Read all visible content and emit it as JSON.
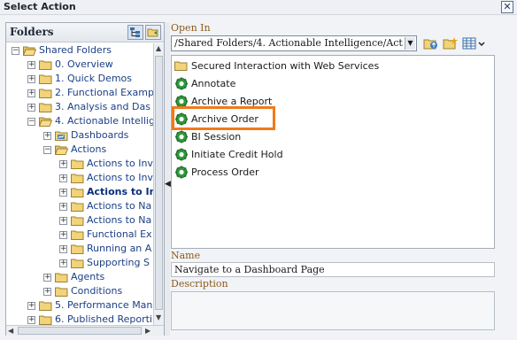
{
  "window": {
    "title": "Select Action",
    "close_glyph": "✕"
  },
  "folders_panel": {
    "header": "Folders",
    "tree": [
      {
        "label": "Shared Folders",
        "level": 0,
        "expander": "−",
        "icon": "folder-open-icon"
      },
      {
        "label": "0. Overview",
        "level": 1,
        "expander": "+",
        "icon": "folder-icon"
      },
      {
        "label": "1. Quick Demos",
        "level": 1,
        "expander": "+",
        "icon": "folder-icon"
      },
      {
        "label": "2. Functional Examp",
        "level": 1,
        "expander": "+",
        "icon": "folder-icon"
      },
      {
        "label": "3. Analysis and Das",
        "level": 1,
        "expander": "+",
        "icon": "folder-icon"
      },
      {
        "label": "4. Actionable Intellig",
        "level": 1,
        "expander": "−",
        "icon": "folder-open-icon"
      },
      {
        "label": "Dashboards",
        "level": 2,
        "expander": "+",
        "icon": "dashboard-folder-icon"
      },
      {
        "label": "Actions",
        "level": 2,
        "expander": "−",
        "icon": "folder-open-icon"
      },
      {
        "label": "Actions to Inv",
        "level": 3,
        "expander": "+",
        "icon": "folder-icon"
      },
      {
        "label": "Actions to Inv",
        "level": 3,
        "expander": "+",
        "icon": "folder-icon"
      },
      {
        "label": "Actions to In",
        "level": 3,
        "expander": "+",
        "icon": "folder-icon",
        "selected": true
      },
      {
        "label": "Actions to Na",
        "level": 3,
        "expander": "+",
        "icon": "folder-icon"
      },
      {
        "label": "Actions to Na",
        "level": 3,
        "expander": "+",
        "icon": "folder-icon"
      },
      {
        "label": "Functional Ex",
        "level": 3,
        "expander": "+",
        "icon": "folder-icon"
      },
      {
        "label": "Running an A",
        "level": 3,
        "expander": "+",
        "icon": "folder-icon"
      },
      {
        "label": "Supporting S",
        "level": 3,
        "expander": "+",
        "icon": "folder-icon"
      },
      {
        "label": "Agents",
        "level": 2,
        "expander": "+",
        "icon": "folder-icon"
      },
      {
        "label": "Conditions",
        "level": 2,
        "expander": "+",
        "icon": "folder-icon"
      },
      {
        "label": "5. Performance Man",
        "level": 1,
        "expander": "+",
        "icon": "folder-icon"
      },
      {
        "label": "6. Published Reporti",
        "level": 1,
        "expander": "+",
        "icon": "folder-icon"
      }
    ]
  },
  "open_in": {
    "label": "Open In",
    "path": "/Shared Folders/4. Actionable Intelligence/Act",
    "toolbar_icons": [
      "up-folder-icon",
      "new-folder-icon",
      "view-options-icon"
    ]
  },
  "items": [
    {
      "label": "Secured Interaction with Web Services",
      "icon": "folder-icon"
    },
    {
      "label": "Annotate",
      "icon": "action-gear-icon"
    },
    {
      "label": "Archive a Report",
      "icon": "action-gear-icon"
    },
    {
      "label": "Archive Order",
      "icon": "action-gear-icon",
      "highlighted": true
    },
    {
      "label": "BI Session",
      "icon": "action-gear-icon"
    },
    {
      "label": "Initiate Credit Hold",
      "icon": "action-gear-icon"
    },
    {
      "label": "Process Order",
      "icon": "action-gear-icon"
    }
  ],
  "name": {
    "label": "Name",
    "value": "Navigate to a Dashboard Page"
  },
  "description": {
    "label": "Description",
    "value": ""
  },
  "colors": {
    "highlight": "#f07a1b",
    "label_color": "#8c5a1c",
    "tree_link": "#1b3f86"
  }
}
